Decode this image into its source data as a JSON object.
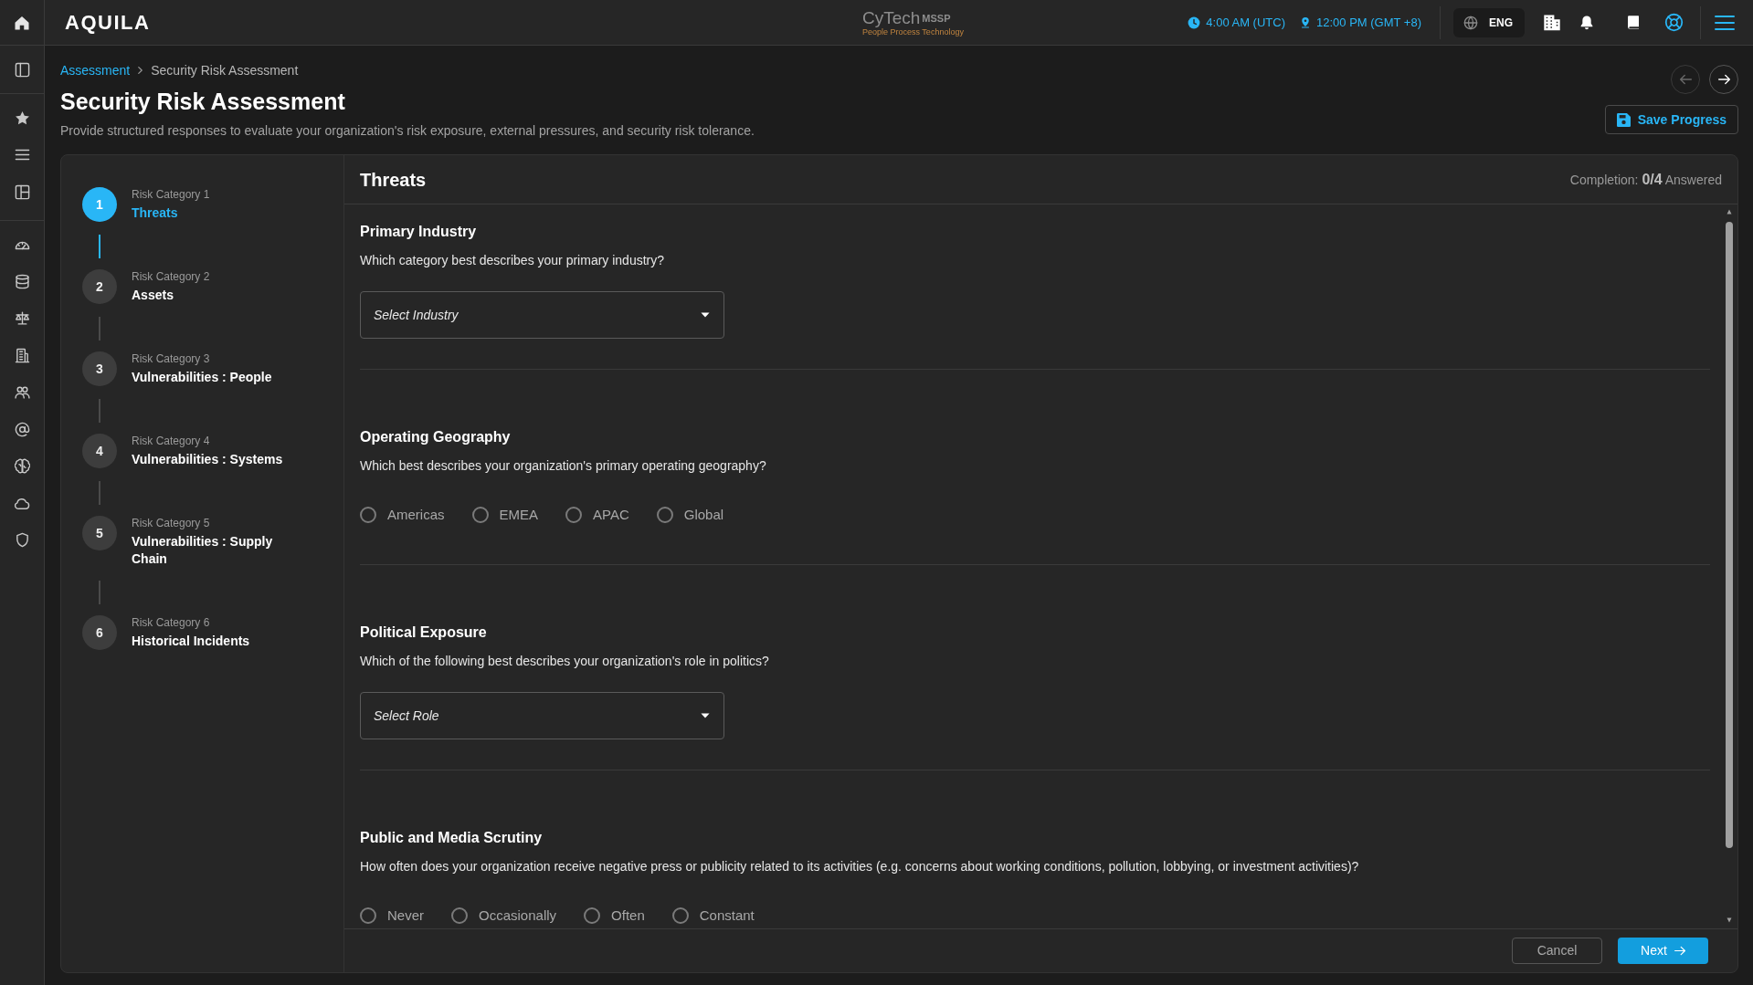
{
  "top_bar": {
    "logo": "AQUILA",
    "brand": {
      "name": "CyTech",
      "suffix": "MSSP",
      "tagline": "People Process Technology"
    },
    "times": [
      {
        "kind": "clock",
        "text": "4:00 AM (UTC)"
      },
      {
        "kind": "location",
        "text": "12:00 PM (GMT +8)"
      }
    ],
    "language": "ENG"
  },
  "breadcrumb": [
    {
      "kind": "link",
      "label": "Assessment"
    },
    {
      "kind": "current",
      "label": "Security Risk Assessment"
    }
  ],
  "page": {
    "title": "Security Risk Assessment",
    "subtitle": "Provide structured responses to evaluate your organization's risk exposure, external pressures, and security risk tolerance."
  },
  "nav_buttons": [
    {
      "kind": "back",
      "disabled": true
    },
    {
      "kind": "forward",
      "disabled": false
    }
  ],
  "save_button": "Save Progress",
  "steps": [
    {
      "number": "1",
      "category": "Risk Category 1",
      "title": "Threats",
      "selected": true
    },
    {
      "number": "2",
      "category": "Risk Category 2",
      "title": "Assets",
      "selected": false
    },
    {
      "number": "3",
      "category": "Risk Category 3",
      "title": "Vulnerabilities : People",
      "selected": false
    },
    {
      "number": "4",
      "category": "Risk Category 4",
      "title": "Vulnerabilities : Systems",
      "selected": false
    },
    {
      "number": "5",
      "category": "Risk Category 5",
      "title": "Vulnerabilities : Supply Chain",
      "selected": false
    },
    {
      "number": "6",
      "category": "Risk Category 6",
      "title": "Historical Incidents",
      "selected": false
    }
  ],
  "section": {
    "title": "Threats",
    "completion": "Completion: **0/4** Answered"
  },
  "questions": [
    {
      "kind": "select",
      "title": "Primary Industry",
      "question": "Which category best describes your primary industry?",
      "placeholder": "Select Industry"
    },
    {
      "kind": "radio",
      "title": "Operating Geography",
      "question": "Which best describes your organization's primary operating geography?",
      "options": [
        {
          "label": "Americas",
          "selected": false
        },
        {
          "label": "EMEA",
          "selected": false
        },
        {
          "label": "APAC",
          "selected": false
        },
        {
          "label": "Global",
          "selected": false
        }
      ]
    },
    {
      "kind": "select",
      "title": "Political Exposure",
      "question": "Which of the following best describes your organization's role in politics?",
      "placeholder": "Select Role"
    },
    {
      "kind": "radio",
      "title": "Public and Media Scrutiny",
      "question": "How often does your organization receive negative press or publicity related to its activities (e.g. concerns about working conditions, pollution, lobbying, or investment activities)?",
      "options": [
        {
          "label": "Never",
          "selected": false
        },
        {
          "label": "Occasionally",
          "selected": false
        },
        {
          "label": "Often",
          "selected": false
        },
        {
          "label": "Constant",
          "selected": false
        }
      ]
    }
  ],
  "footer": {
    "cancel": "Cancel",
    "next": "Next"
  }
}
